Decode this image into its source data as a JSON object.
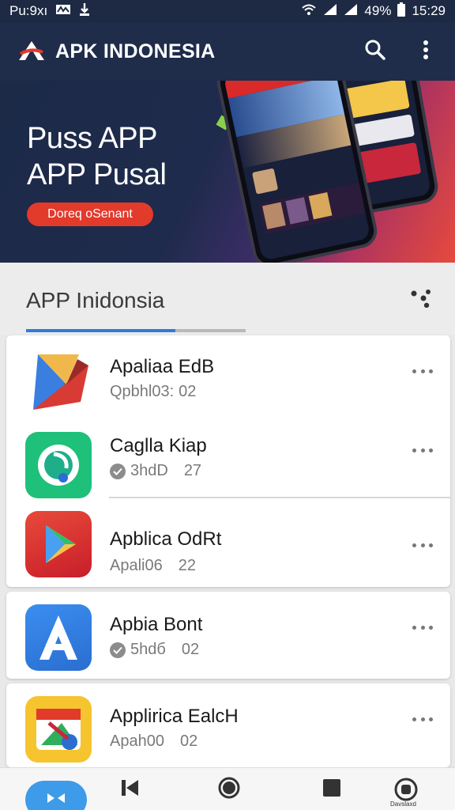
{
  "status_bar": {
    "left_text": "Pu:9xı",
    "battery": "49%",
    "time": "15:29"
  },
  "app": {
    "title": "APK INDONESIA",
    "icons": [
      "logo-icon",
      "search-icon",
      "more-vertical-icon"
    ]
  },
  "banner": {
    "title": "Puss APP\nAPP Pusal",
    "cta_label": "Doreq oSenant"
  },
  "section": {
    "title": "APP Inidonsia",
    "tab_progress": 0.68
  },
  "apps": [
    {
      "name": "Apaliaa EdB",
      "meta": "Qpbhl03:",
      "value": "02",
      "icon": "red-blue-fold-icon",
      "verified": false
    },
    {
      "name": "Caglla Kiap",
      "meta": "3hdD",
      "value": "27",
      "icon": "green-maps-icon",
      "verified": true
    },
    {
      "name": "Apblica OdRt",
      "meta": "Apali06",
      "value": "22",
      "icon": "play-triangle-icon",
      "verified": false
    },
    {
      "name": "Apbia Bont",
      "meta": "5hdб",
      "value": "02",
      "icon": "letter-a-icon",
      "verified": true
    },
    {
      "name": "Applirica EalcH",
      "meta": "Apah00",
      "value": "02",
      "icon": "colorful-calendar-icon",
      "verified": false
    }
  ],
  "bottom_nav": {
    "items": [
      "home-icon",
      "back-icon",
      "circle-icon",
      "square-icon",
      "profile-icon"
    ],
    "profile_label": "Davslaxd"
  },
  "colors": {
    "header_bg": "#1f2c4a",
    "accent_blue": "#2f7bd8",
    "cta_red": "#e23a2b"
  }
}
